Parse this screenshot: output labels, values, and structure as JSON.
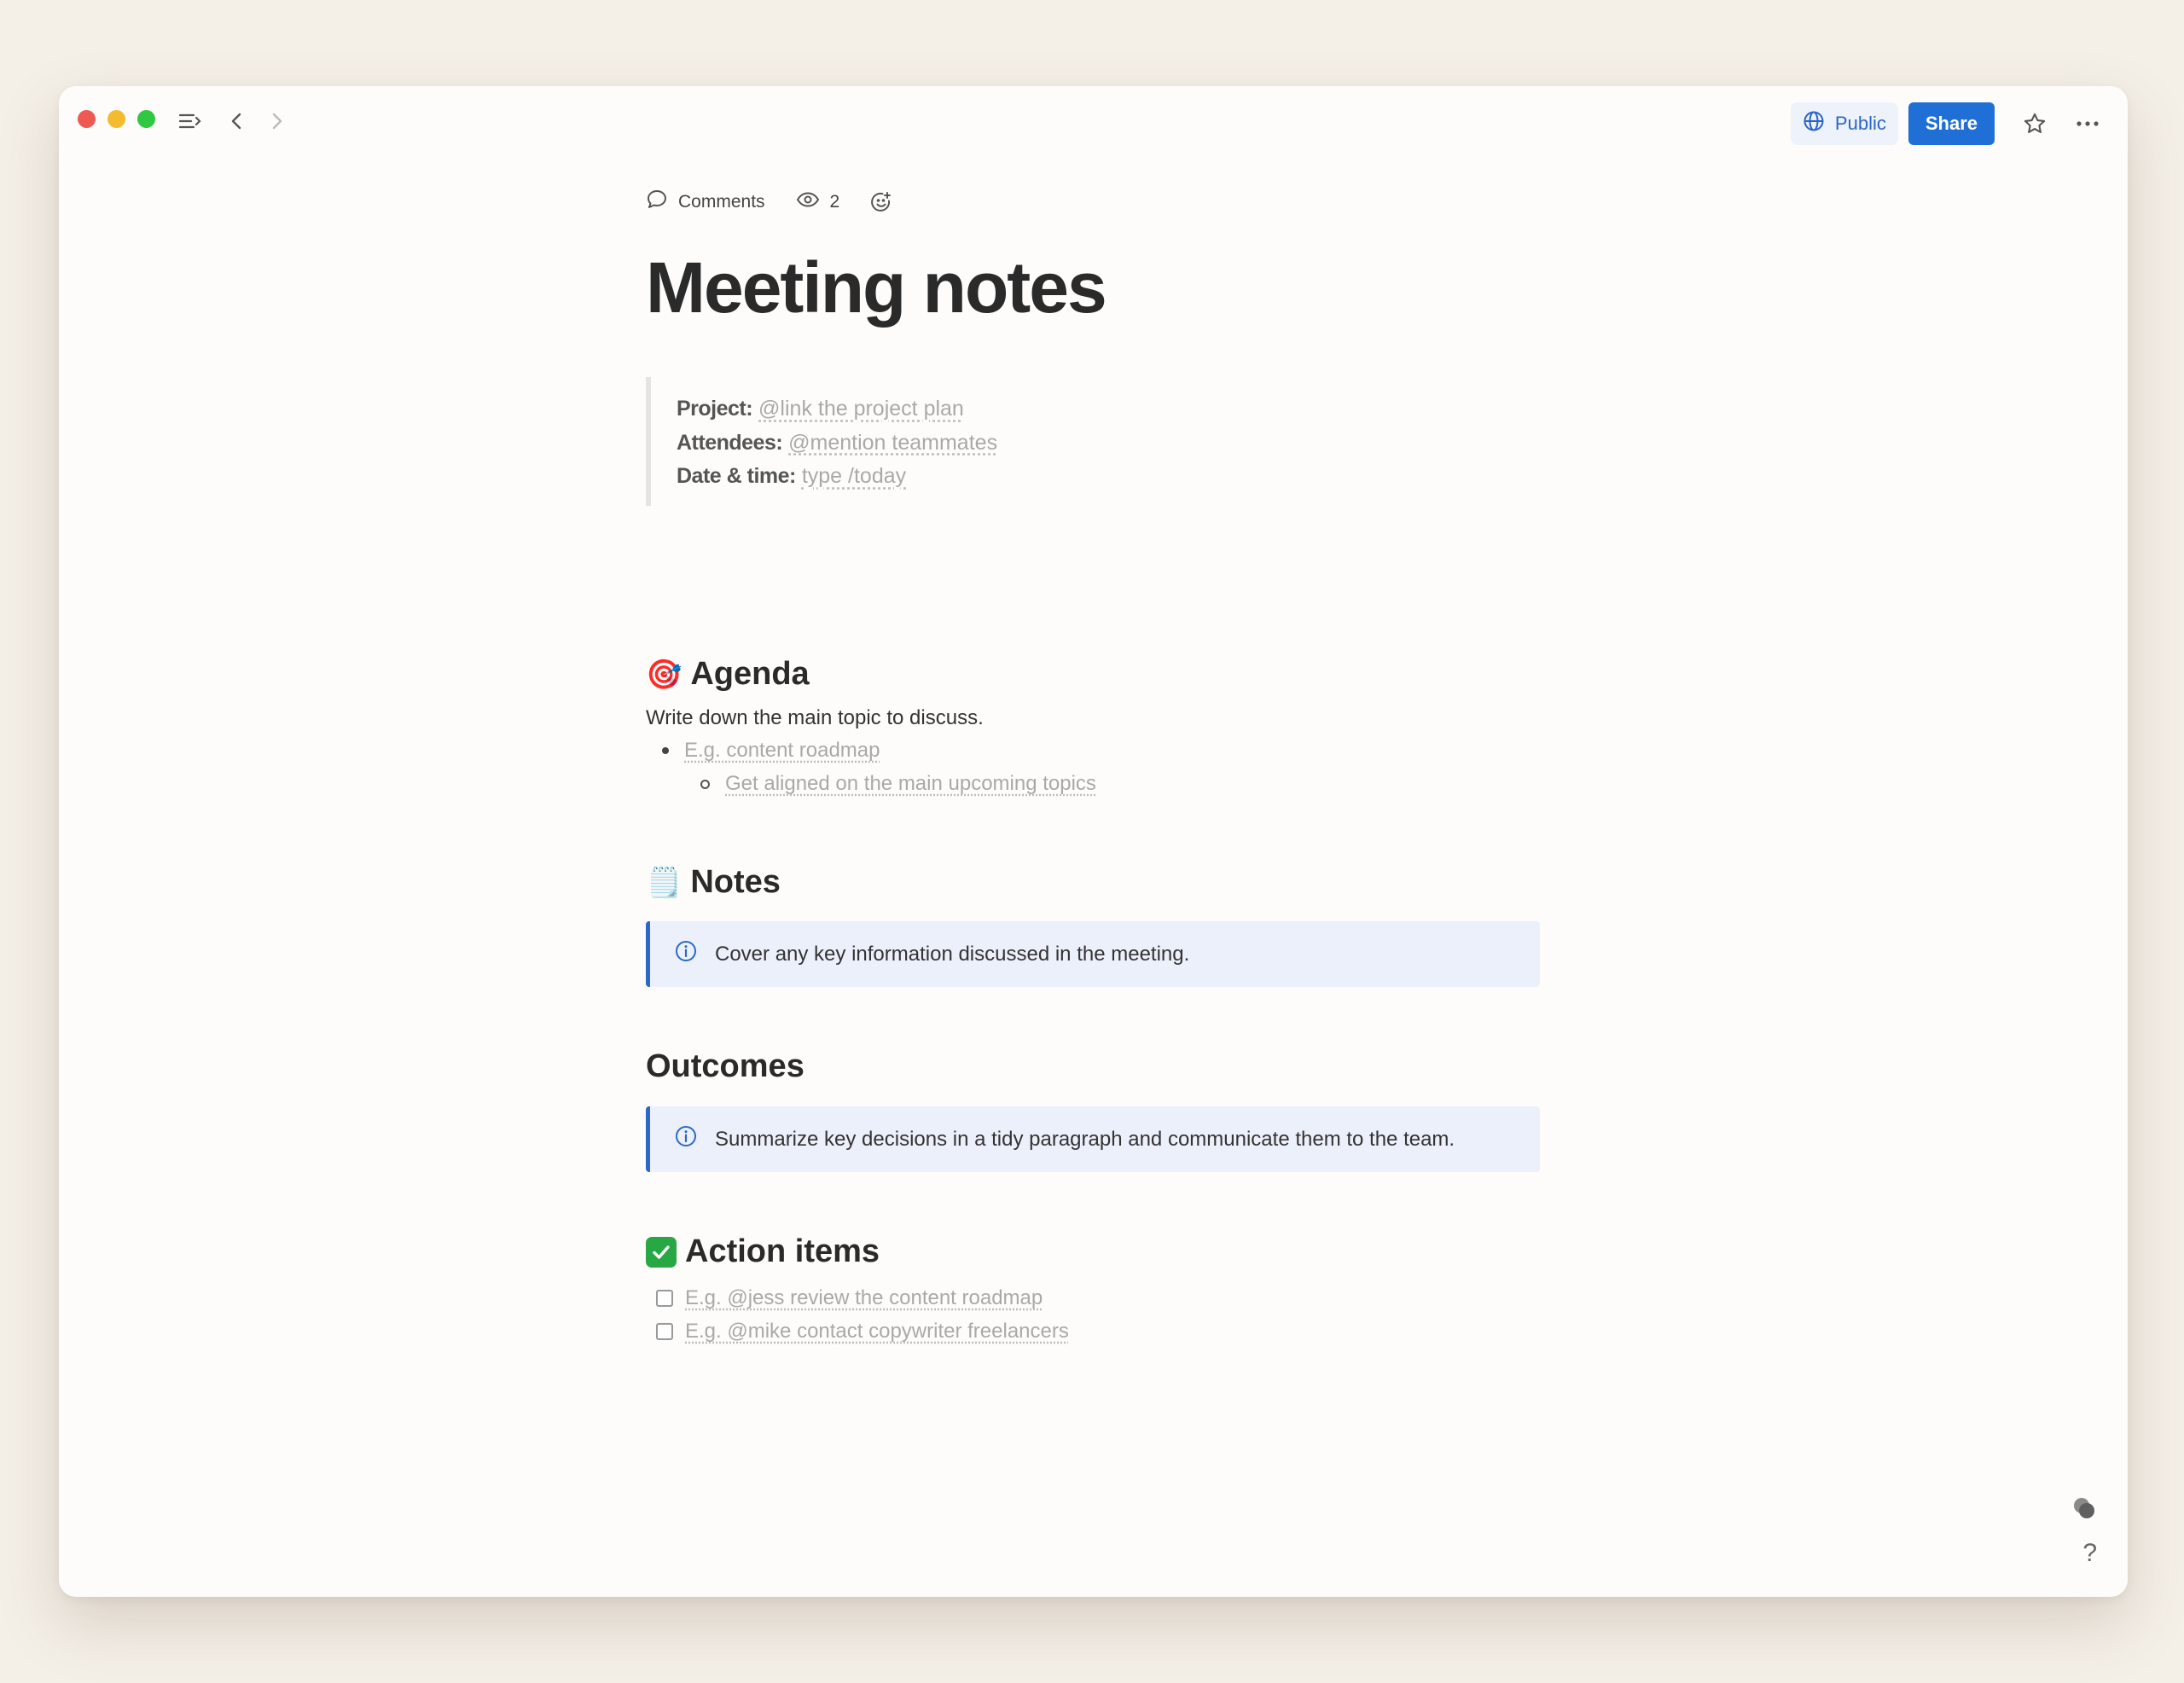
{
  "toolbar": {
    "public_label": "Public",
    "share_label": "Share"
  },
  "meta": {
    "comments_label": "Comments",
    "views_count": "2"
  },
  "page": {
    "title": "Meeting notes",
    "properties": [
      {
        "key": "Project:",
        "value": "@link the project plan"
      },
      {
        "key": "Attendees:",
        "value": "@mention teammates"
      },
      {
        "key": "Date & time:",
        "value": "type /today"
      }
    ]
  },
  "agenda": {
    "heading": "Agenda",
    "emoji": "🎯",
    "description": "Write down the main topic to discuss.",
    "bullet": "E.g. content roadmap",
    "sub_bullet": "Get aligned on the main upcoming topics"
  },
  "notes": {
    "heading": "Notes",
    "emoji": "🗒️",
    "callout": "Cover any key information discussed in the meeting."
  },
  "outcomes": {
    "heading": "Outcomes",
    "callout": "Summarize key decisions in a tidy paragraph and communicate them to the team."
  },
  "action_items": {
    "heading": "Action items",
    "items": [
      "E.g. @jess review the content roadmap",
      "E.g. @mike contact copywriter freelancers"
    ]
  },
  "footer": {
    "help_label": "?"
  },
  "colors": {
    "accent": "#1f6fd6",
    "callout_bg": "#ecf0fb",
    "callout_border": "#2b68c8",
    "background": "#f4efe7"
  }
}
